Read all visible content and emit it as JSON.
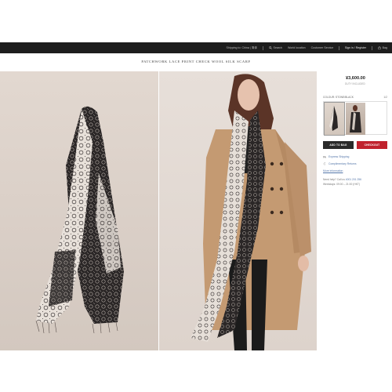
{
  "topnav": {
    "country": "Shipping to: China | 简体",
    "search": "Search",
    "world_location": "World location",
    "customer_service": "Customer Service",
    "sign_in": "Sign in / Register",
    "bag": "Bag"
  },
  "product": {
    "title": "PATCHWORK LACE PRINT CHECK WOOL SILK SCARF",
    "price": "¥3,600.00",
    "duty": "DUTY INCLUDED",
    "colour_label": "COLOUR: STONE/BLACK",
    "view_all": "1/2",
    "add_to_bag": "ADD TO BAG",
    "checkout": "CHECKOUT"
  },
  "services": {
    "shipping": "Express Shipping",
    "returns": "Complimentary Returns",
    "more": "More information"
  },
  "contact": {
    "question_label": "Need help? Call us",
    "phone": "4001 201 256",
    "hours": "Weekdays: 09:00 – 21:00 (HKT)"
  },
  "colors": {
    "topbar": "#1d1d1d",
    "checkout": "#c0222d",
    "add_to_bag": "#2a2a2a",
    "link": "#5577aa"
  }
}
